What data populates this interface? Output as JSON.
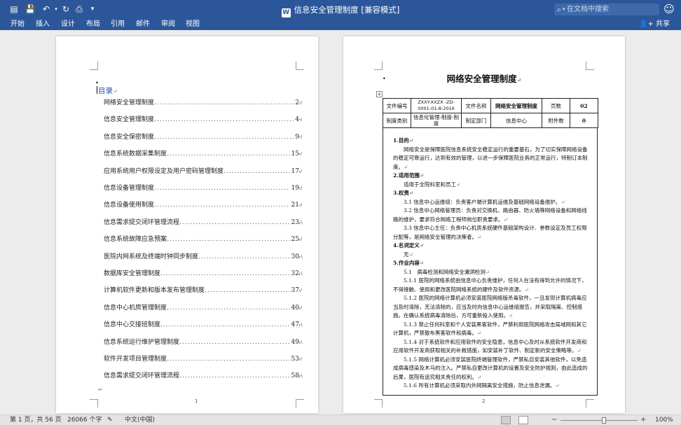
{
  "titlebar": {
    "doc_title": "信息安全管理制度 [兼容模式]",
    "app_glyph": "W",
    "search_placeholder": "在文档中搜索",
    "icons": [
      "sidebar-icon",
      "save-icon",
      "undo-icon",
      "redo-icon",
      "print-icon",
      "customize-icon",
      "search-icon",
      "smiley-icon"
    ]
  },
  "ribbon": {
    "tabs": [
      "开始",
      "插入",
      "设计",
      "布局",
      "引用",
      "邮件",
      "审阅",
      "视图"
    ],
    "share_label": "共享"
  },
  "toc": {
    "heading": "目录",
    "entries": [
      {
        "title": "网络安全管理制度",
        "page": "2"
      },
      {
        "title": "信息安全管理制度",
        "page": "4"
      },
      {
        "title": "信息安全保密制度",
        "page": "9"
      },
      {
        "title": "信息系统数据采集制度",
        "page": "15"
      },
      {
        "title": "应用系统用户权限设定及用户密码管理制度",
        "page": "17"
      },
      {
        "title": "信息设备管理制度",
        "page": "19"
      },
      {
        "title": "信息设备使用制度",
        "page": "21"
      },
      {
        "title": "信息需求提交闭环管理流程",
        "page": "23"
      },
      {
        "title": "信息系统故障应急预案",
        "page": "25"
      },
      {
        "title": "医院内网系统及终端时钟同步制度",
        "page": "30"
      },
      {
        "title": "数据库安全管理制度",
        "page": "32"
      },
      {
        "title": "计算机软件更新和版本发布管理制度",
        "page": "37"
      },
      {
        "title": "信息中心机房管理制度",
        "page": "40"
      },
      {
        "title": "信息中心交接班制度",
        "page": "47"
      },
      {
        "title": "信息系统运行维护管理制度",
        "page": "49"
      },
      {
        "title": "软件开发项目管理制度",
        "page": "53"
      },
      {
        "title": "信息需求提交闭环管理流程",
        "page": "58"
      }
    ],
    "page_number": "1"
  },
  "page2": {
    "title": "网络安全管理制度",
    "page_number": "2",
    "meta_row1": [
      "文件编号",
      "ZXXY-XXZX -ZD-0001-01-8-2016",
      "文件名称",
      "网络安全管理制度",
      "页数",
      "02"
    ],
    "meta_row2": [
      "制度类别",
      "信息化管理-制度-制度",
      "制定部门",
      "信息中心",
      "附件数",
      "0"
    ],
    "paragraphs": [
      {
        "cls": "sec",
        "text": "1.目的"
      },
      {
        "cls": "ind",
        "text": "网络安全是保障医院信息系统安全稳定运行的重要基石，为了切实保障网络设备的稳定可靠运行，达到有效的管理，以进一步保障医院业务的正常运行，特制订本制度。"
      },
      {
        "cls": "sec",
        "text": "2.适用范围"
      },
      {
        "cls": "ind",
        "text": "适用于全院科室和员工"
      },
      {
        "cls": "sec",
        "text": "3.权责"
      },
      {
        "cls": "ind",
        "text": "3.1 信息中心运维组：负责客户端计算机运维及基础网络设备维护。"
      },
      {
        "cls": "ind",
        "text": "3.2 信息中心网络管理员：负责对交换机、路由器、防火墙等网络设备和网络线路的维护，要求符合网络工程师岗位职责要求。"
      },
      {
        "cls": "ind",
        "text": "3.3 信息中心主任：负责中心机房系统硬件基础架构设计、参数设定及员工权限分配等，是网络安全管理的决策者。"
      },
      {
        "cls": "sec",
        "text": "4.名词定义"
      },
      {
        "cls": "ind",
        "text": "无"
      },
      {
        "cls": "sec",
        "text": "5.作业内容"
      },
      {
        "cls": "ind",
        "text": "5.1　病毒检测和网络安全漏洞检测"
      },
      {
        "cls": "ind",
        "text": "5.1.1 医院的网络系统由信息中心负责维护，任何人在没有得到允许的情况下，不得接触、使用和更改医院网络系统的硬件及软件资源。"
      },
      {
        "cls": "ind",
        "text": "5.1.2 医院的网络计算机必须安装医院网络版杀毒软件，一旦发现计算机病毒应当及时清除，无法清除的，应当及时向信息中心运维组报告，并采取隔离、控制措施。在确认系统病毒清除后，方可重新投入使用。"
      },
      {
        "cls": "ind",
        "text": "5.1.3 禁止任何科室和个人安装黑客软件，严禁利用医院网络攻击局域网和其它计算机，严禁散布黑客软件和病毒。"
      },
      {
        "cls": "ind",
        "text": "5.1.4 对于系统软件和应用软件的安全隐患，信息中心及时从系统软件开发商和应用软件开发商获取相关的补救措施，如安装补丁软件、制定新的安全策略等。"
      },
      {
        "cls": "ind",
        "text": "5.1.5 网络计算机必须安装医院终端管理软件，严禁私自安装其他软件，以免造成病毒感染及木马的注入。严禁私自更改计算机的设置及安全防护规则，由此造成的后果，医院有追究相关责任的权利。"
      },
      {
        "cls": "ind",
        "text": "5.1.6 所有计算机必须采取内外网隔离安全措施，防止信息泄漏。"
      }
    ]
  },
  "statusbar": {
    "page_info": "第 1 页，共 56 页",
    "word_count": "26066 个字",
    "language": "中文(中国)",
    "zoom": "100%",
    "zoom_level": 1.0
  }
}
